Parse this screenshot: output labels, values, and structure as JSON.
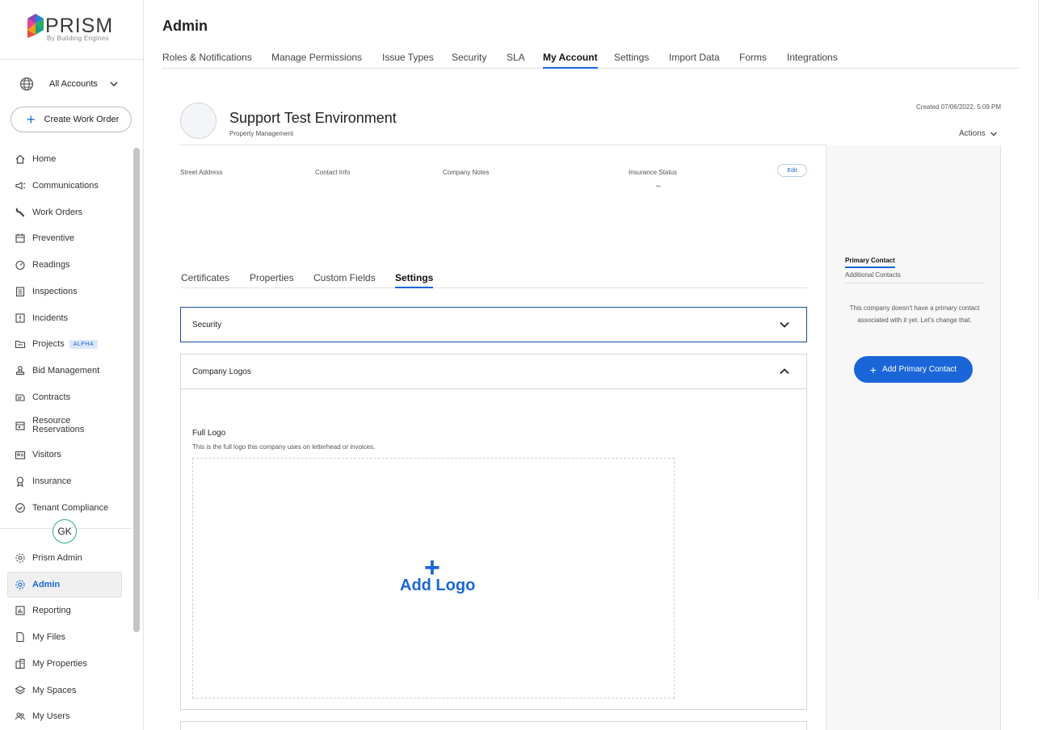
{
  "brand": {
    "name": "PRISM",
    "tagline": "By Building Engines"
  },
  "accounts": {
    "label": "All Accounts"
  },
  "create_button": {
    "label": "Create Work Order"
  },
  "nav": {
    "items": [
      {
        "label": "Home"
      },
      {
        "label": "Communications"
      },
      {
        "label": "Work Orders"
      },
      {
        "label": "Preventive"
      },
      {
        "label": "Readings"
      },
      {
        "label": "Inspections"
      },
      {
        "label": "Incidents"
      },
      {
        "label": "Projects",
        "badge": "ALPHA"
      },
      {
        "label": "Bid Management"
      },
      {
        "label": "Contracts"
      },
      {
        "label": "Resource Reservations"
      },
      {
        "label": "Visitors"
      },
      {
        "label": "Insurance"
      },
      {
        "label": "Tenant Compliance"
      }
    ],
    "avatar_initials": "GK",
    "bottom_items": [
      {
        "label": "Prism Admin"
      },
      {
        "label": "Admin"
      },
      {
        "label": "Reporting"
      },
      {
        "label": "My Files"
      },
      {
        "label": "My Properties"
      },
      {
        "label": "My Spaces"
      },
      {
        "label": "My Users"
      }
    ]
  },
  "page": {
    "title": "Admin",
    "tabs": [
      {
        "label": "Roles & Notifications"
      },
      {
        "label": "Manage Permissions"
      },
      {
        "label": "Issue Types"
      },
      {
        "label": "Security"
      },
      {
        "label": "SLA"
      },
      {
        "label": "My Account"
      },
      {
        "label": "Settings"
      },
      {
        "label": "Import Data"
      },
      {
        "label": "Forms"
      },
      {
        "label": "Integrations"
      }
    ],
    "active_tab": "My Account"
  },
  "company": {
    "name": "Support Test Environment",
    "type": "Property Management",
    "created": "Created 07/06/2022, 5:09 PM",
    "actions_label": "Actions",
    "info_labels": {
      "street": "Street Address",
      "contact": "Contact Info",
      "notes": "Company Notes",
      "insurance": "Insurance Status"
    },
    "insurance_value": "–",
    "edit_label": "Edit"
  },
  "subtabs": [
    {
      "label": "Certificates"
    },
    {
      "label": "Properties"
    },
    {
      "label": "Custom Fields"
    },
    {
      "label": "Settings"
    }
  ],
  "sections": {
    "security": {
      "title": "Security"
    },
    "logos": {
      "title": "Company Logos",
      "full_logo_title": "Full Logo",
      "full_logo_desc": "This is the full logo this company uses on letterhead or invoices.",
      "add_logo_label": "Add Logo"
    }
  },
  "contacts_panel": {
    "primary_tab": "Primary Contact",
    "additional_tab": "Additional Contacts",
    "empty_message": "This company doesn't have a primary contact associated with it yet. Let's change that.",
    "add_button": "Add Primary Contact"
  },
  "colors": {
    "accent": "#1a66d9",
    "border": "#d5d5d5",
    "avatar_ring": "#2fa88f"
  }
}
